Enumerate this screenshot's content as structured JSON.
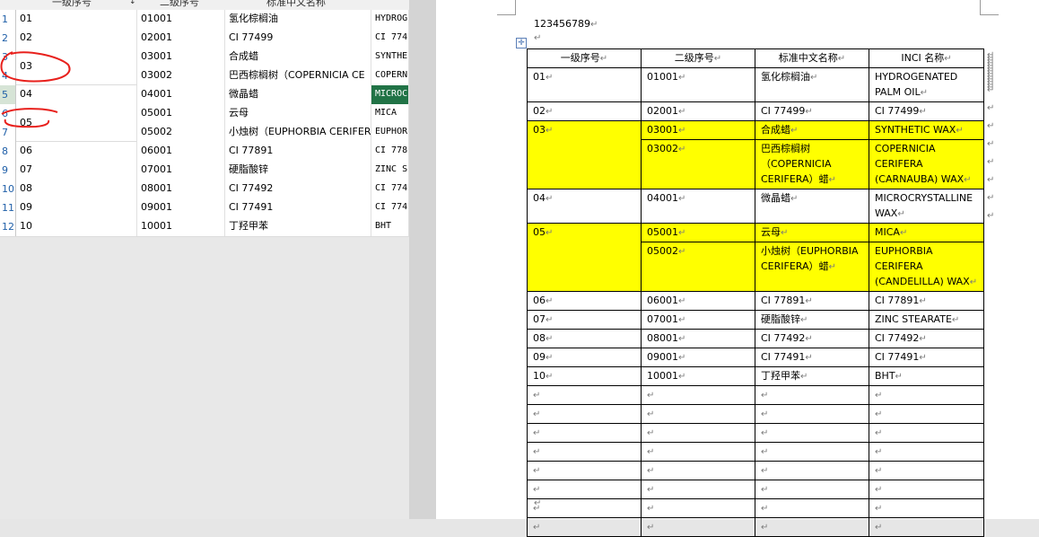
{
  "sheet": {
    "headers": [
      "一级序号",
      "二级序号",
      "标准中文名称"
    ],
    "rows": [
      {
        "n": "1",
        "a": "01",
        "b": "01001",
        "c": "氢化棕榈油",
        "d": "HYDROG"
      },
      {
        "n": "2",
        "a": "02",
        "b": "02001",
        "c": "CI 77499",
        "d": "CI 774"
      },
      {
        "n": "3",
        "a": "",
        "b": "03001",
        "c": "合成蜡",
        "d": "SYNTHE"
      },
      {
        "n": "4",
        "a": "",
        "b": "03002",
        "c": "巴西棕榈树（COPERNICIA CE",
        "d": "COPERN"
      },
      {
        "n": "5",
        "a": "04",
        "b": "04001",
        "c": "微晶蜡",
        "d": "MICROC"
      },
      {
        "n": "6",
        "a": "",
        "b": "05001",
        "c": "云母",
        "d": "MICA"
      },
      {
        "n": "7",
        "a": "",
        "b": "05002",
        "c": "小烛树（EUPHORBIA CERIFER",
        "d": "EUPHOR"
      },
      {
        "n": "8",
        "a": "06",
        "b": "06001",
        "c": "CI 77891",
        "d": "CI 778"
      },
      {
        "n": "9",
        "a": "07",
        "b": "07001",
        "c": "硬脂酸锌",
        "d": "ZINC S"
      },
      {
        "n": "10",
        "a": "08",
        "b": "08001",
        "c": "CI 77492",
        "d": "CI 774"
      },
      {
        "n": "11",
        "a": "09",
        "b": "09001",
        "c": "CI 77491",
        "d": "CI 774"
      },
      {
        "n": "12",
        "a": "10",
        "b": "10001",
        "c": "丁羟甲苯",
        "d": "BHT"
      }
    ],
    "merged_03": "03",
    "merged_05": "05"
  },
  "doc": {
    "para1": "123456789",
    "move_icon": "✛",
    "mark": "↵",
    "headers": [
      "一级序号",
      "二级序号",
      "标准中文名称",
      "INCI 名称"
    ],
    "r01": {
      "a": "01",
      "b": "01001",
      "c": "氢化棕榈油",
      "d": "HYDROGENATED PALM OIL"
    },
    "r02": {
      "a": "02",
      "b": "02001",
      "c": "CI 77499",
      "d": "CI 77499"
    },
    "g03": {
      "a": "03",
      "b1": "03001",
      "c1": "合成蜡",
      "d1": "SYNTHETIC WAX",
      "b2": "03002",
      "c2": "巴西棕榈树（COPERNICIA CERIFERA）蜡",
      "d2": "COPERNICIA CERIFERA (CARNAUBA) WAX"
    },
    "r04": {
      "a": "04",
      "b": "04001",
      "c": "微晶蜡",
      "d": "MICROCRYSTALLINE WAX"
    },
    "g05": {
      "a": "05",
      "b1": "05001",
      "c1": "云母",
      "d1": "MICA",
      "b2": "05002",
      "c2": "小烛树（EUPHORBIA CERIFERA）蜡",
      "d2": "EUPHORBIA CERIFERA (CANDELILLA) WAX"
    },
    "r06": {
      "a": "06",
      "b": "06001",
      "c": "CI 77891",
      "d": "CI 77891"
    },
    "r07": {
      "a": "07",
      "b": "07001",
      "c": "硬脂酸锌",
      "d": "ZINC STEARATE"
    },
    "r08": {
      "a": "08",
      "b": "08001",
      "c": "CI 77492",
      "d": "CI 77492"
    },
    "r09": {
      "a": "09",
      "b": "09001",
      "c": "CI 77491",
      "d": "CI 77491"
    },
    "r10": {
      "a": "10",
      "b": "10001",
      "c": "丁羟甲苯",
      "d": "BHT"
    }
  },
  "colors": {
    "highlight": "#ffff00",
    "annotation": "#e8201c",
    "selected_cell": "#217346"
  }
}
